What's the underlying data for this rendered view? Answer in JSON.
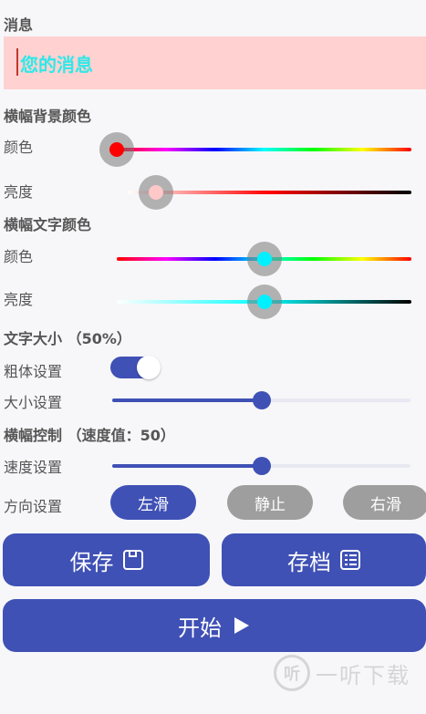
{
  "message": {
    "title": "消息",
    "value": "您的消息"
  },
  "banner_bg": {
    "title": "横幅背景颜色",
    "color_label": "颜色",
    "color_value": 0.0,
    "brightness_label": "亮度",
    "brightness_value": 0.04,
    "selected_color": "#ff0000",
    "brightness_color": "#ffc8c8"
  },
  "banner_text": {
    "title": "横幅文字颜色",
    "color_label": "颜色",
    "color_value": 0.5,
    "brightness_label": "亮度",
    "brightness_value": 0.5,
    "selected_color": "#00f0ff"
  },
  "text_size": {
    "title": "文字大小 （50%）",
    "bold_label": "粗体设置",
    "bold_on": true,
    "size_label": "大小设置",
    "size_value": 0.5
  },
  "banner_control": {
    "title": "横幅控制 （速度值：50）",
    "speed_label": "速度设置",
    "speed_value": 0.5,
    "direction_label": "方向设置",
    "directions": [
      "左滑",
      "静止",
      "右滑"
    ],
    "selected_direction": "左滑"
  },
  "buttons": {
    "save": "保存",
    "archive": "存档",
    "start": "开始"
  },
  "watermark": {
    "text": "一听下载",
    "logo_char": "听"
  },
  "colors": {
    "accent": "#3f51b5",
    "inactive": "#9e9e9e"
  }
}
